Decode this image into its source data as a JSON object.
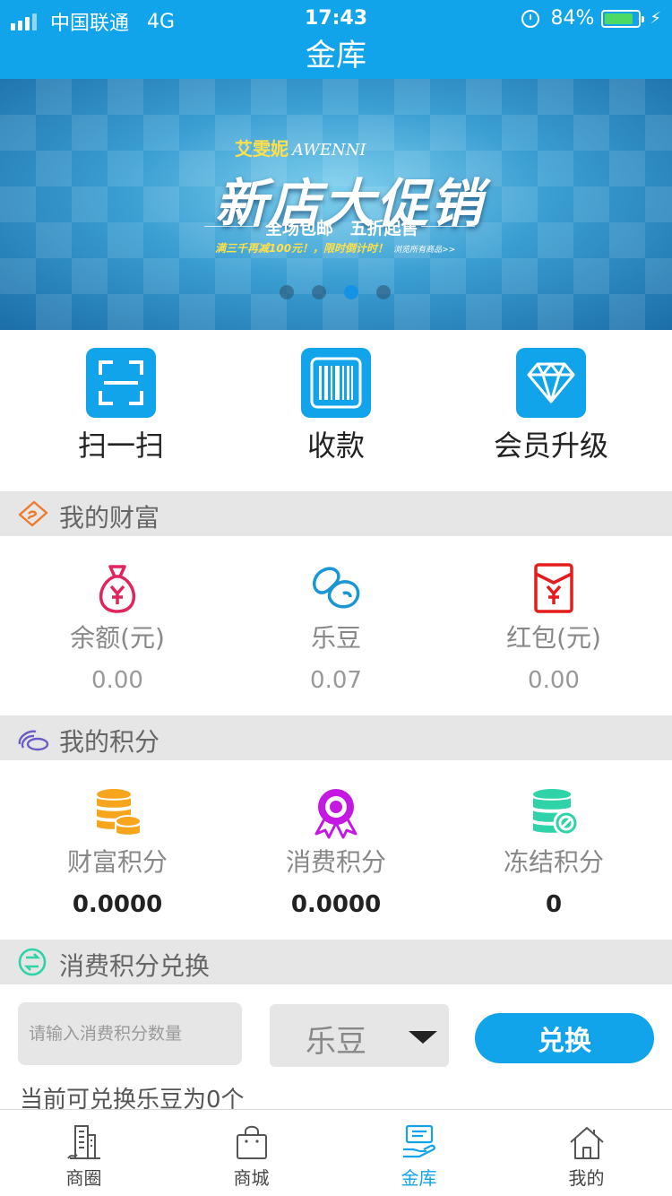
{
  "status": {
    "carrier": "中国联通",
    "network": "4G",
    "time": "17:43",
    "battery": "84%",
    "battery_level": 0.84
  },
  "header": {
    "title": "金库"
  },
  "banner": {
    "brand_cn": "艾雯妮",
    "brand_en": "AWENNI",
    "headline": "新店大促销",
    "subline": "全场包邮  五折起售",
    "promo": "满三千再减100元！，限时倒计时！",
    "promo_small": "浏览所有商品>>",
    "slide_count": 4,
    "active_slide": 3
  },
  "quick_actions": [
    {
      "label": "扫一扫",
      "icon": "scan-icon"
    },
    {
      "label": "收款",
      "icon": "barcode-icon"
    },
    {
      "label": "会员升级",
      "icon": "diamond-icon"
    }
  ],
  "wealth": {
    "title": "我的财富",
    "items": [
      {
        "name": "余额(元)",
        "value": "0.00",
        "icon": "money-bag-icon"
      },
      {
        "name": "乐豆",
        "value": "0.07",
        "icon": "bean-icon"
      },
      {
        "name": "红包(元)",
        "value": "0.00",
        "icon": "red-packet-icon"
      }
    ]
  },
  "points": {
    "title": "我的积分",
    "items": [
      {
        "name": "财富积分",
        "value": "0.0000",
        "icon": "coin-stack-icon"
      },
      {
        "name": "消费积分",
        "value": "0.0000",
        "icon": "medal-icon"
      },
      {
        "name": "冻结积分",
        "value": "0",
        "icon": "frozen-database-icon"
      }
    ]
  },
  "exchange": {
    "title": "消费积分兑换",
    "input_placeholder": "请输入消费积分数量",
    "selected": "乐豆",
    "button": "兑换",
    "note": "当前可兑换乐豆为0个"
  },
  "tabs": [
    {
      "label": "商圈",
      "icon": "building-icon"
    },
    {
      "label": "商城",
      "icon": "shopping-bag-icon"
    },
    {
      "label": "金库",
      "icon": "vault-icon",
      "active": true
    },
    {
      "label": "我的",
      "icon": "home-icon"
    }
  ],
  "colors": {
    "primary": "#11a4ea",
    "section_bg": "#e6e6e6",
    "wealth_pink": "#e2245c",
    "points_orange": "#f7a51c",
    "points_purple": "#c319e0",
    "points_teal": "#2ed3a8"
  }
}
